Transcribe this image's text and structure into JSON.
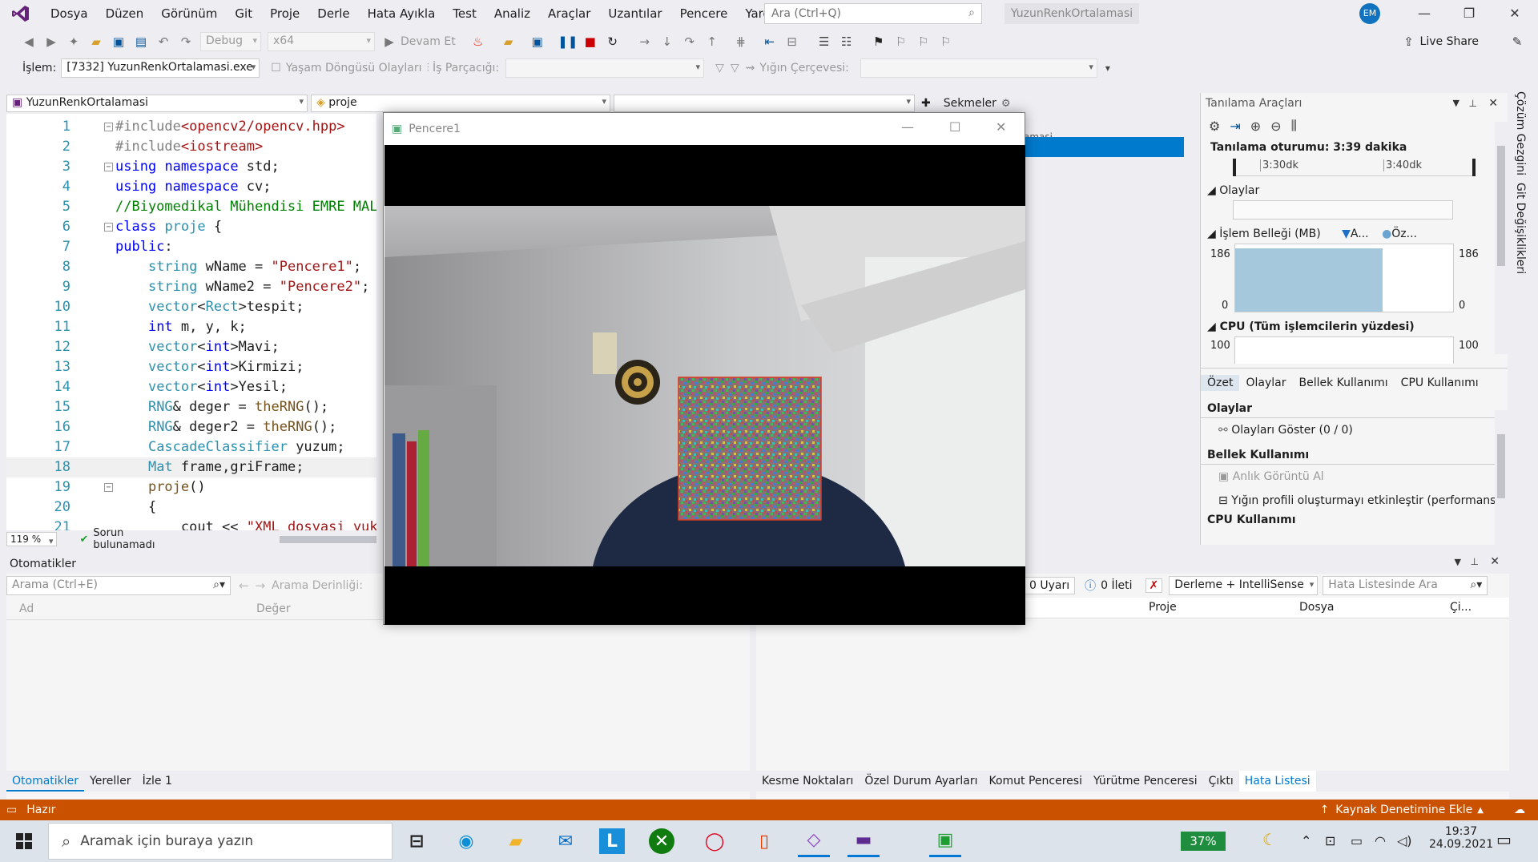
{
  "menu": {
    "items": [
      "Dosya",
      "Düzen",
      "Görünüm",
      "Git",
      "Proje",
      "Derle",
      "Hata Ayıkla",
      "Test",
      "Analiz",
      "Araçlar",
      "Uzantılar",
      "Pencere",
      "Yardım"
    ],
    "search_placeholder": "Ara (Ctrl+Q)",
    "app_title": "YuzunRenkOrtalamasi",
    "avatar_initials": "EM"
  },
  "toolbar": {
    "config": "Debug",
    "platform": "x64",
    "continue_label": "Devam Et",
    "live_share": "Live Share"
  },
  "toolbar2": {
    "process_label": "İşlem:",
    "process_value": "[7332] YuzunRenkOrtalamasi.exe",
    "lifecycle_label": "Yaşam Döngüsü Olayları",
    "thread_label": "İş Parçacığı:",
    "stack_label": "Yığın Çerçevesi:"
  },
  "editor": {
    "file_combo": "YuzunRenkOrtalamasi",
    "scope_combo": "proje",
    "member_combo": "",
    "tabs_label": "Sekmeler",
    "zoom": "119 %",
    "status": "Sorun bulunamadı",
    "partial_tab": "amasi"
  },
  "code": {
    "lines": [
      {
        "n": "1",
        "fold": "−",
        "segs": [
          [
            "p",
            "#include"
          ],
          [
            "s",
            "<opencv2/opencv.hpp>"
          ]
        ]
      },
      {
        "n": "2",
        "fold": "",
        "segs": [
          [
            "p",
            "#include"
          ],
          [
            "s",
            "<iostream>"
          ]
        ]
      },
      {
        "n": "3",
        "fold": "−",
        "segs": [
          [
            "k",
            "using"
          ],
          [
            "x",
            " "
          ],
          [
            "k",
            "namespace"
          ],
          [
            "x",
            " std;"
          ]
        ]
      },
      {
        "n": "4",
        "fold": "",
        "segs": [
          [
            "k",
            "using"
          ],
          [
            "x",
            " "
          ],
          [
            "k",
            "namespace"
          ],
          [
            "x",
            " cv;"
          ]
        ]
      },
      {
        "n": "5",
        "fold": "",
        "segs": [
          [
            "c",
            "//Biyomedikal Mühendisi EMRE MALTA"
          ]
        ]
      },
      {
        "n": "6",
        "fold": "−",
        "segs": [
          [
            "k",
            "class"
          ],
          [
            "x",
            " "
          ],
          [
            "t",
            "proje"
          ],
          [
            "x",
            " {"
          ]
        ]
      },
      {
        "n": "7",
        "fold": "",
        "segs": [
          [
            "k",
            "public"
          ],
          [
            "x",
            ":"
          ]
        ]
      },
      {
        "n": "8",
        "fold": "",
        "segs": [
          [
            "x",
            "    "
          ],
          [
            "t",
            "string"
          ],
          [
            "x",
            " wName = "
          ],
          [
            "s",
            "\"Pencere1\""
          ],
          [
            "x",
            ";"
          ]
        ]
      },
      {
        "n": "9",
        "fold": "",
        "segs": [
          [
            "x",
            "    "
          ],
          [
            "t",
            "string"
          ],
          [
            "x",
            " wName2 = "
          ],
          [
            "s",
            "\"Pencere2\""
          ],
          [
            "x",
            ";"
          ]
        ]
      },
      {
        "n": "10",
        "fold": "",
        "segs": [
          [
            "x",
            "    "
          ],
          [
            "t",
            "vector"
          ],
          [
            "x",
            "<"
          ],
          [
            "t",
            "Rect"
          ],
          [
            "x",
            ">tespit;"
          ]
        ]
      },
      {
        "n": "11",
        "fold": "",
        "segs": [
          [
            "x",
            "    "
          ],
          [
            "k",
            "int"
          ],
          [
            "x",
            " m, y, k;"
          ]
        ]
      },
      {
        "n": "12",
        "fold": "",
        "segs": [
          [
            "x",
            "    "
          ],
          [
            "t",
            "vector"
          ],
          [
            "x",
            "<"
          ],
          [
            "k",
            "int"
          ],
          [
            "x",
            ">Mavi;"
          ]
        ]
      },
      {
        "n": "13",
        "fold": "",
        "segs": [
          [
            "x",
            "    "
          ],
          [
            "t",
            "vector"
          ],
          [
            "x",
            "<"
          ],
          [
            "k",
            "int"
          ],
          [
            "x",
            ">Kirmizi;"
          ]
        ]
      },
      {
        "n": "14",
        "fold": "",
        "segs": [
          [
            "x",
            "    "
          ],
          [
            "t",
            "vector"
          ],
          [
            "x",
            "<"
          ],
          [
            "k",
            "int"
          ],
          [
            "x",
            ">Yesil;"
          ]
        ]
      },
      {
        "n": "15",
        "fold": "",
        "segs": [
          [
            "x",
            "    "
          ],
          [
            "t",
            "RNG"
          ],
          [
            "x",
            "& deger = "
          ],
          [
            "f",
            "theRNG"
          ],
          [
            "x",
            "();"
          ]
        ]
      },
      {
        "n": "16",
        "fold": "",
        "segs": [
          [
            "x",
            "    "
          ],
          [
            "t",
            "RNG"
          ],
          [
            "x",
            "& deger2 = "
          ],
          [
            "f",
            "theRNG"
          ],
          [
            "x",
            "();"
          ]
        ]
      },
      {
        "n": "17",
        "fold": "",
        "segs": [
          [
            "x",
            "    "
          ],
          [
            "t",
            "CascadeClassifier"
          ],
          [
            "x",
            " yuzum;"
          ]
        ]
      },
      {
        "n": "18",
        "fold": "",
        "segs": [
          [
            "x",
            "    "
          ],
          [
            "t",
            "Mat"
          ],
          [
            "x",
            " frame,griFrame;"
          ]
        ]
      },
      {
        "n": "19",
        "fold": "−",
        "segs": [
          [
            "x",
            "    "
          ],
          [
            "f",
            "proje"
          ],
          [
            "x",
            "()"
          ]
        ]
      },
      {
        "n": "20",
        "fold": "",
        "segs": [
          [
            "x",
            "    {"
          ]
        ]
      },
      {
        "n": "21",
        "fold": "",
        "segs": [
          [
            "x",
            "        cout << "
          ],
          [
            "s",
            "\"XML dosyasi yukleniyor\""
          ]
        ]
      }
    ]
  },
  "diag": {
    "title": "Tanılama Araçları",
    "session": "Tanılama oturumu: 3:39 dakika",
    "t1": "3:30dk",
    "t2": "3:40dk",
    "events_label": "Olaylar",
    "mem_label": "İşlem Belleği (MB)",
    "mem_leg1": "A...",
    "mem_leg2": "Öz...",
    "mem_max": "186",
    "mem_min": "0",
    "cpu_label": "CPU (Tüm işlemcilerin yüzdesi)",
    "cpu_max": "100",
    "tabs": [
      "Özet",
      "Olaylar",
      "Bellek Kullanımı",
      "CPU Kullanımı"
    ],
    "sum_events": "Olaylar",
    "show_events": "Olayları Göster (0 / 0)",
    "mem_usage": "Bellek Kullanımı",
    "snapshot": "Anlık Görüntü Al",
    "heap": "Yığın profili oluşturmayı etkinleştir (performans",
    "cpu_usage": "CPU Kullanımı",
    "memory_fill_percent": 94
  },
  "side_tabs": [
    "Çözüm Gezgini",
    "Git Değişiklikleri"
  ],
  "autos": {
    "title": "Otomatikler",
    "search_placeholder": "Arama (Ctrl+E)",
    "depth_label": "Arama Derinliği:",
    "col_name": "Ad",
    "col_value": "Değer",
    "tabs": [
      "Otomatikler",
      "Yereller",
      "İzle 1"
    ]
  },
  "errors": {
    "warnings": "0 Uyarı",
    "messages": "0 İleti",
    "filter": "Derleme + IntelliSense",
    "search_placeholder": "Hata Listesinde Ara",
    "cols": [
      "Proje",
      "Dosya",
      "Çi..."
    ],
    "tabs": [
      "Kesme Noktaları",
      "Özel Durum Ayarları",
      "Komut Penceresi",
      "Yürütme Penceresi",
      "Çıktı",
      "Hata Listesi"
    ]
  },
  "status": {
    "ready": "Hazır",
    "source_control": "Kaynak Denetimine Ekle"
  },
  "taskbar": {
    "search_placeholder": "Aramak için buraya yazın",
    "battery": "37%",
    "time": "19:37",
    "date": "24.09.2021"
  },
  "popup": {
    "title": "Pencere1"
  },
  "colors": {
    "accent": "#007acc",
    "status_bar": "#ca5100",
    "memory_chart": "#a6c8dc"
  }
}
